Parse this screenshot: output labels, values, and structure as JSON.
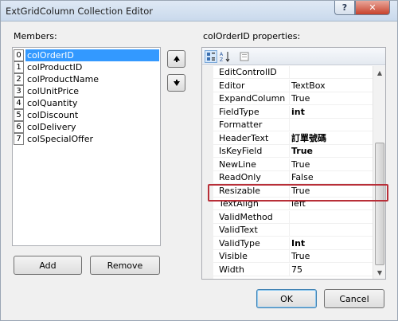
{
  "window": {
    "title": "ExtGridColumn Collection Editor",
    "help_label": "?",
    "close_label": "✕"
  },
  "members": {
    "label": "Members:",
    "items": [
      {
        "index": "0",
        "name": "colOrderID",
        "selected": true
      },
      {
        "index": "1",
        "name": "colProductID",
        "selected": false
      },
      {
        "index": "2",
        "name": "colProductName",
        "selected": false
      },
      {
        "index": "3",
        "name": "colUnitPrice",
        "selected": false
      },
      {
        "index": "4",
        "name": "colQuantity",
        "selected": false
      },
      {
        "index": "5",
        "name": "colDiscount",
        "selected": false
      },
      {
        "index": "6",
        "name": "colDelivery",
        "selected": false
      },
      {
        "index": "7",
        "name": "colSpecialOffer",
        "selected": false
      }
    ],
    "add_label": "Add",
    "remove_label": "Remove",
    "move_up_icon": "arrow-up-icon",
    "move_down_icon": "arrow-down-icon"
  },
  "properties": {
    "label": "colOrderID properties:",
    "toolbar": {
      "categorized_icon": "categorized-icon",
      "alphabetical_icon": "alphabetical-icon",
      "property_pages_icon": "property-pages-icon"
    },
    "rows": [
      {
        "name": "EditControlID",
        "value": "",
        "bold": false
      },
      {
        "name": "Editor",
        "value": "TextBox",
        "bold": false
      },
      {
        "name": "ExpandColumn",
        "value": "True",
        "bold": false
      },
      {
        "name": "FieldType",
        "value": "int",
        "bold": true
      },
      {
        "name": "Formatter",
        "value": "",
        "bold": false
      },
      {
        "name": "HeaderText",
        "value": "訂單號碼",
        "bold": true
      },
      {
        "name": "IsKeyField",
        "value": "True",
        "bold": true
      },
      {
        "name": "NewLine",
        "value": "True",
        "bold": false
      },
      {
        "name": "ReadOnly",
        "value": "False",
        "bold": false
      },
      {
        "name": "Resizable",
        "value": "True",
        "bold": false
      },
      {
        "name": "TextAlign",
        "value": "left",
        "bold": false
      },
      {
        "name": "ValidMethod",
        "value": "",
        "bold": false
      },
      {
        "name": "ValidText",
        "value": "",
        "bold": false
      },
      {
        "name": "ValidType",
        "value": "Int",
        "bold": true
      },
      {
        "name": "Visible",
        "value": "True",
        "bold": false
      },
      {
        "name": "Width",
        "value": "75",
        "bold": false
      }
    ],
    "highlighted_row": "Resizable"
  },
  "footer": {
    "ok_label": "OK",
    "cancel_label": "Cancel"
  },
  "colors": {
    "selection": "#3399ff",
    "highlight_border": "#b82f38",
    "close_button": "#c7422c"
  }
}
